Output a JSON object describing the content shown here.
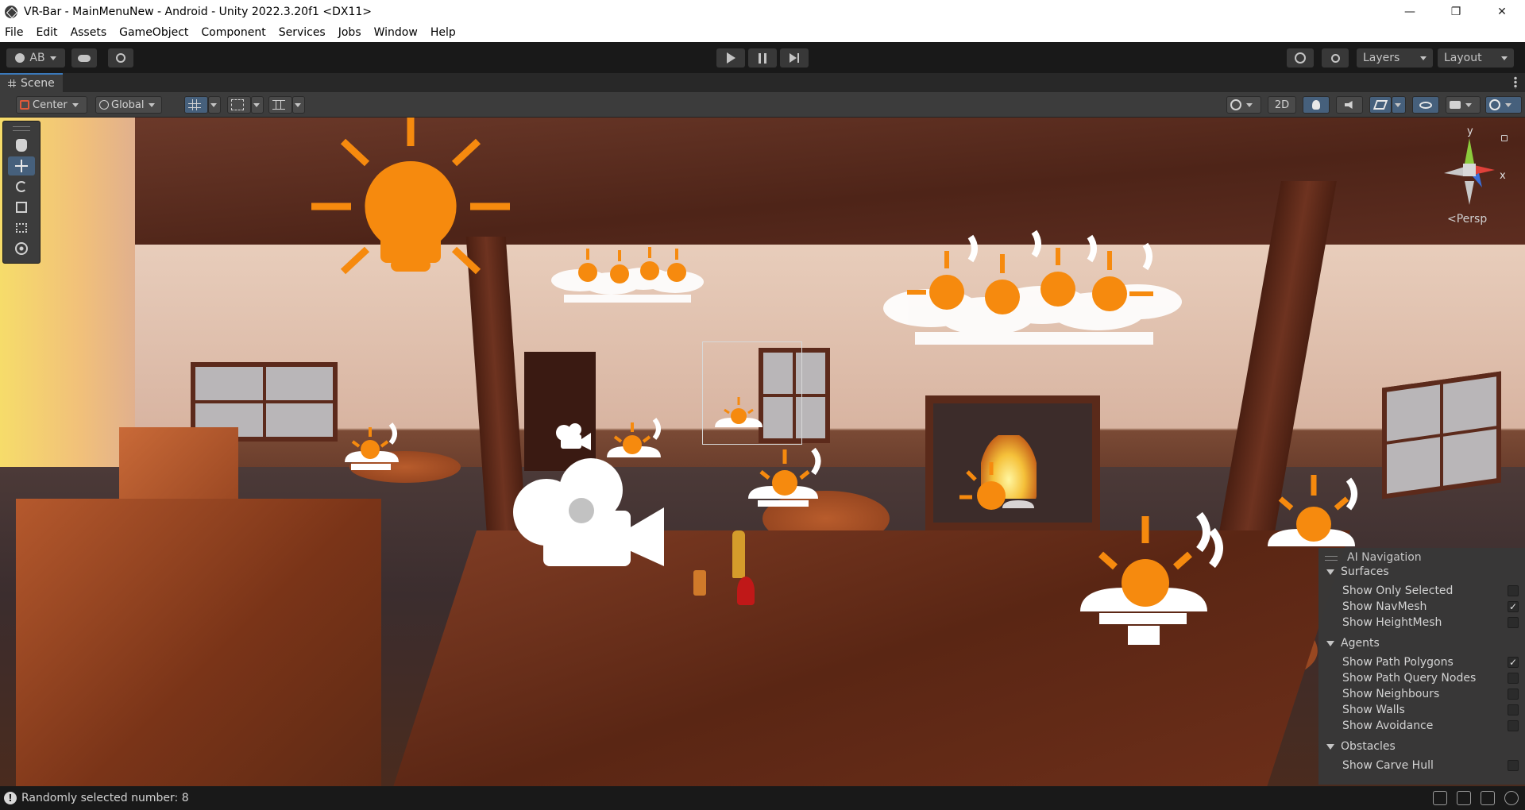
{
  "window": {
    "title": "VR-Bar - MainMenuNew - Android - Unity 2022.3.20f1 <DX11>",
    "minimize": "—",
    "maximize": "❐",
    "close": "✕"
  },
  "menu": [
    "File",
    "Edit",
    "Assets",
    "GameObject",
    "Component",
    "Services",
    "Jobs",
    "Window",
    "Help"
  ],
  "toolbar": {
    "account_label": "AB",
    "layers_label": "Layers",
    "layout_label": "Layout"
  },
  "scene_tab": {
    "label": "Scene"
  },
  "scene_toolbar": {
    "pivot_label": "Center",
    "space_label": "Global",
    "mode_2d_label": "2D"
  },
  "orientation": {
    "y_axis": "y",
    "x_axis": "x",
    "projection": "<Persp"
  },
  "ai_navigation": {
    "title": "AI Navigation",
    "surfaces": {
      "heading": "Surfaces",
      "items": [
        {
          "label": "Show Only Selected",
          "checked": false
        },
        {
          "label": "Show NavMesh",
          "checked": true
        },
        {
          "label": "Show HeightMesh",
          "checked": false
        }
      ]
    },
    "agents": {
      "heading": "Agents",
      "items": [
        {
          "label": "Show Path Polygons",
          "checked": true
        },
        {
          "label": "Show Path Query Nodes",
          "checked": false
        },
        {
          "label": "Show Neighbours",
          "checked": false
        },
        {
          "label": "Show Walls",
          "checked": false
        },
        {
          "label": "Show Avoidance",
          "checked": false
        }
      ]
    },
    "obstacles": {
      "heading": "Obstacles",
      "items": [
        {
          "label": "Show Carve Hull",
          "checked": false
        }
      ]
    }
  },
  "status": {
    "message": "Randomly selected number: 8"
  },
  "colors": {
    "accent": "#46607c",
    "gizmo_orange": "#f68a0e",
    "tab_highlight": "#3a79bb"
  }
}
